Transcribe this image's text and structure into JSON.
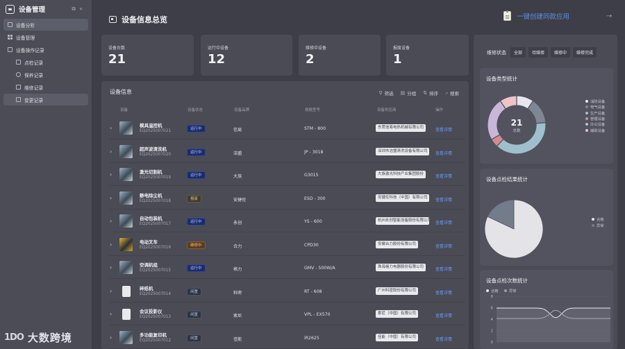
{
  "sidebar": {
    "title": "设备管理",
    "items": [
      {
        "label": "设备分析"
      },
      {
        "label": "设备管理"
      },
      {
        "label": "设备操作记录"
      },
      {
        "label": "点检记录"
      },
      {
        "label": "保养记录"
      },
      {
        "label": "维修记录"
      },
      {
        "label": "变更记录"
      }
    ]
  },
  "watermark": {
    "logo": "1DO",
    "text": "大数跨境"
  },
  "header": {
    "title": "设备信息总览",
    "link": "一键创建同款应用"
  },
  "stats": [
    {
      "label": "设备台数",
      "value": "21"
    },
    {
      "label": "运行中设备",
      "value": "12"
    },
    {
      "label": "维修中设备",
      "value": "2"
    },
    {
      "label": "报废设备",
      "value": "1"
    }
  ],
  "table": {
    "title": "设备信息",
    "tools": [
      "筛选",
      "分组",
      "排序",
      "搜索"
    ],
    "columns": [
      "设备",
      "设备状态",
      "设备品牌",
      "规格型号",
      "设备供应商",
      "操作"
    ],
    "rows": [
      {
        "name": "模具温控机",
        "code": "EQ2025007021",
        "status": "运行中",
        "status_type": "run",
        "brand": "信易",
        "model": "STM - 800",
        "supplier": "东莞信易电热机械有限公司",
        "action": "查看详情",
        "thumb": "machine"
      },
      {
        "name": "超声波清洗机",
        "code": "EQ2025007020",
        "status": "运行中",
        "status_type": "run",
        "brand": "洁盟",
        "model": "JP - 3018",
        "supplier": "深圳市洁盟清洗设备有限公司",
        "action": "查看详情",
        "thumb": "machine"
      },
      {
        "name": "激光切割机",
        "code": "EQ2025007019",
        "status": "运行中",
        "status_type": "run",
        "brand": "大族",
        "model": "G3015",
        "supplier": "大族激光科技产业集团股份",
        "action": "查看详情",
        "thumb": "machine"
      },
      {
        "name": "静电除尘机",
        "code": "EQ2025007018",
        "status": "报废",
        "status_type": "scrap",
        "brand": "安捷伦",
        "model": "ESD - 300",
        "supplier": "安捷伦科技（中国）有限公司",
        "action": "查看详情",
        "thumb": "machine"
      },
      {
        "name": "自动包装机",
        "code": "EQ2025007017",
        "status": "运行中",
        "status_type": "run",
        "brand": "永创",
        "model": "YS - 600",
        "supplier": "杭州永创智能设备股份有限公司",
        "action": "查看详情",
        "thumb": "machine"
      },
      {
        "name": "电动叉车",
        "code": "EQ2025007016",
        "status": "维修中",
        "status_type": "fix",
        "brand": "合力",
        "model": "CPD30",
        "supplier": "安徽合力股份有限公司",
        "action": "查看详情",
        "thumb": "forklift"
      },
      {
        "name": "空调机组",
        "code": "EQ2025007015",
        "status": "运行中",
        "status_type": "run",
        "brand": "格力",
        "model": "GMV - 500W/A",
        "supplier": "珠海格力电器股份有限公司",
        "action": "查看详情",
        "thumb": "machine"
      },
      {
        "name": "碎纸机",
        "code": "EQ2025007014",
        "status": "闲置",
        "status_type": "idle",
        "brand": "科密",
        "model": "RT - 608",
        "supplier": "广州科密股份有限公司",
        "action": "查看详情",
        "thumb": "doc"
      },
      {
        "name": "会议投影仪",
        "code": "EQ2025007013",
        "status": "闲置",
        "status_type": "idle",
        "brand": "索尼",
        "model": "VPL - EX570",
        "supplier": "索尼（中国）有限公司",
        "action": "查看详情",
        "thumb": "doc"
      },
      {
        "name": "多功能复印机",
        "code": "EQ2025007012",
        "status": "闲置",
        "status_type": "idle",
        "brand": "佳能",
        "model": "iR2625",
        "supplier": "佳能（中国）有限公司",
        "action": "查看详情",
        "thumb": "machine"
      }
    ]
  },
  "filter": {
    "label": "维修状态",
    "options": [
      "全部",
      "待维修",
      "维修中",
      "维修完成"
    ]
  },
  "chart_data": [
    {
      "type": "pie",
      "title": "设备类型统计",
      "center_value": "21",
      "center_label": "总数",
      "categories": [
        "消防设备",
        "电气设备",
        "生产设备",
        "管理设备",
        "办公设备",
        "辅助设备"
      ],
      "values": [
        2,
        3,
        8,
        1,
        5,
        2
      ],
      "colors": [
        "#e8e8ec",
        "#7e8796",
        "#9fbfcc",
        "#d48b8d",
        "#c9b6d8",
        "#f0c3c6"
      ],
      "legend": "right"
    },
    {
      "type": "pie",
      "title": "设备点检结果统计",
      "categories": [
        "合格",
        "异常"
      ],
      "values": [
        82,
        18
      ],
      "colors": [
        "#e4e4e8",
        "#737c8b"
      ],
      "legend": "right"
    },
    {
      "type": "area",
      "title": "设备点检次数统计",
      "series": [
        {
          "name": "合格"
        },
        {
          "name": "异常"
        }
      ],
      "ylim": [
        0,
        8
      ],
      "yticks": [
        "8",
        "6",
        "4",
        "2",
        "0"
      ],
      "legend": "top-left"
    }
  ]
}
